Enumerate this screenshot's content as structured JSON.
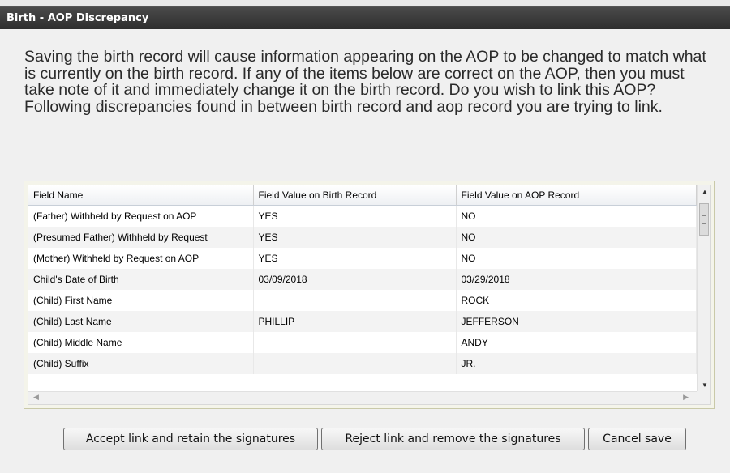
{
  "dialog": {
    "title": "Birth - AOP Discrepancy",
    "message_line1": "Saving the birth record will cause information appearing on the AOP to be changed to match what is currently on the birth record. If any of the items below are correct on the AOP, then you must take note of it and immediately change it on the birth record. Do you wish to link this AOP?",
    "message_line2": "Following discrepancies found in between birth record and aop record you are trying to link."
  },
  "grid": {
    "headers": [
      "Field Name",
      "Field Value on Birth Record",
      "Field Value on AOP Record"
    ],
    "rows": [
      [
        "(Father) Withheld by Request on AOP",
        "YES",
        "NO"
      ],
      [
        "(Presumed Father) Withheld by Request",
        "YES",
        "NO"
      ],
      [
        "(Mother) Withheld by Request on AOP",
        "YES",
        "NO"
      ],
      [
        "Child's Date of Birth",
        "03/09/2018",
        "03/29/2018"
      ],
      [
        "(Child) First Name",
        "",
        "ROCK"
      ],
      [
        "(Child) Last Name",
        "PHILLIP",
        "JEFFERSON"
      ],
      [
        "(Child) Middle Name",
        "",
        "ANDY"
      ],
      [
        "(Child) Suffix",
        "",
        "JR."
      ]
    ]
  },
  "buttons": {
    "accept": "Accept link and retain the signatures",
    "reject": "Reject link and remove the signatures",
    "cancel": "Cancel save"
  }
}
